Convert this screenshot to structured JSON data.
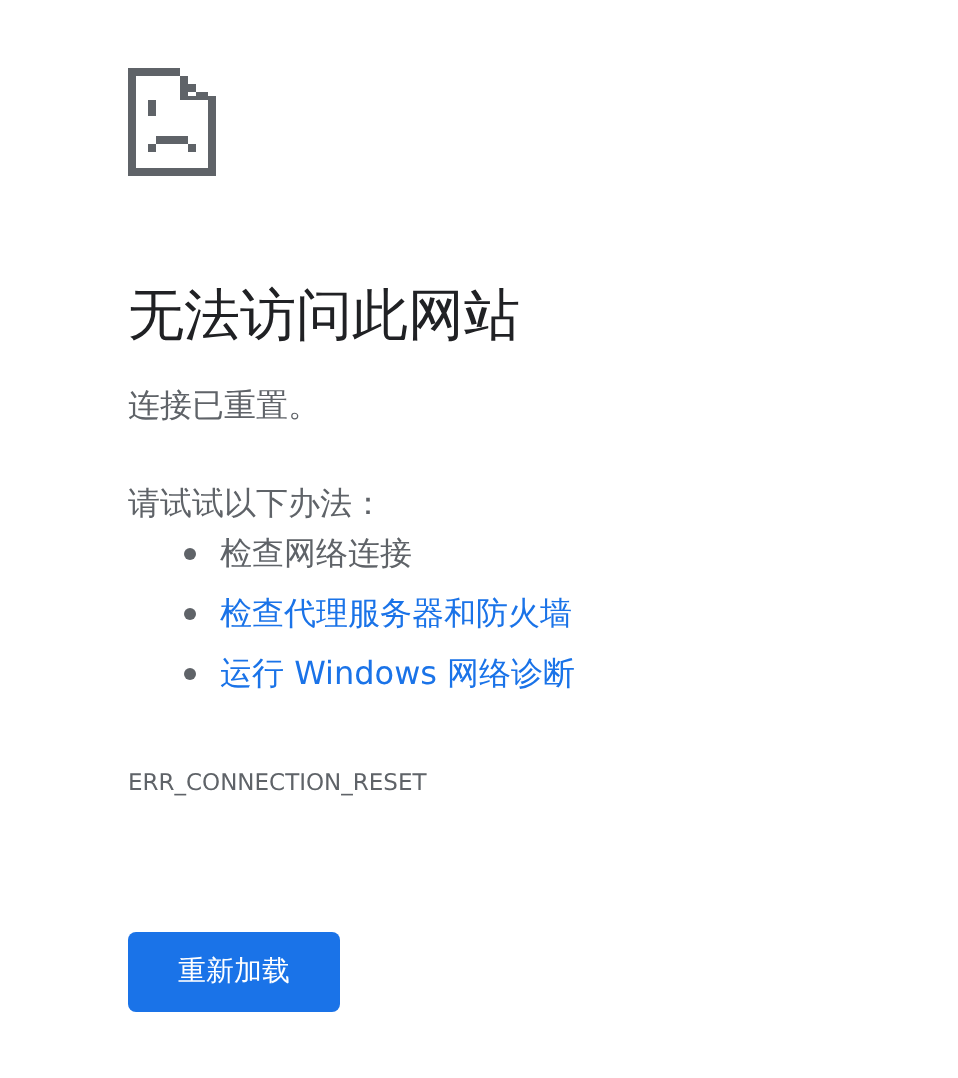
{
  "heading": "无法访问此网站",
  "message": "连接已重置。",
  "suggestions": {
    "intro": "请试试以下办法：",
    "items": [
      {
        "kind": "text",
        "label": "检查网络连接"
      },
      {
        "kind": "link",
        "label": "检查代理服务器和防火墙"
      },
      {
        "kind": "link",
        "label": "运行 Windows 网络诊断"
      }
    ]
  },
  "error_code": "ERR_CONNECTION_RESET",
  "button": "重新加载"
}
